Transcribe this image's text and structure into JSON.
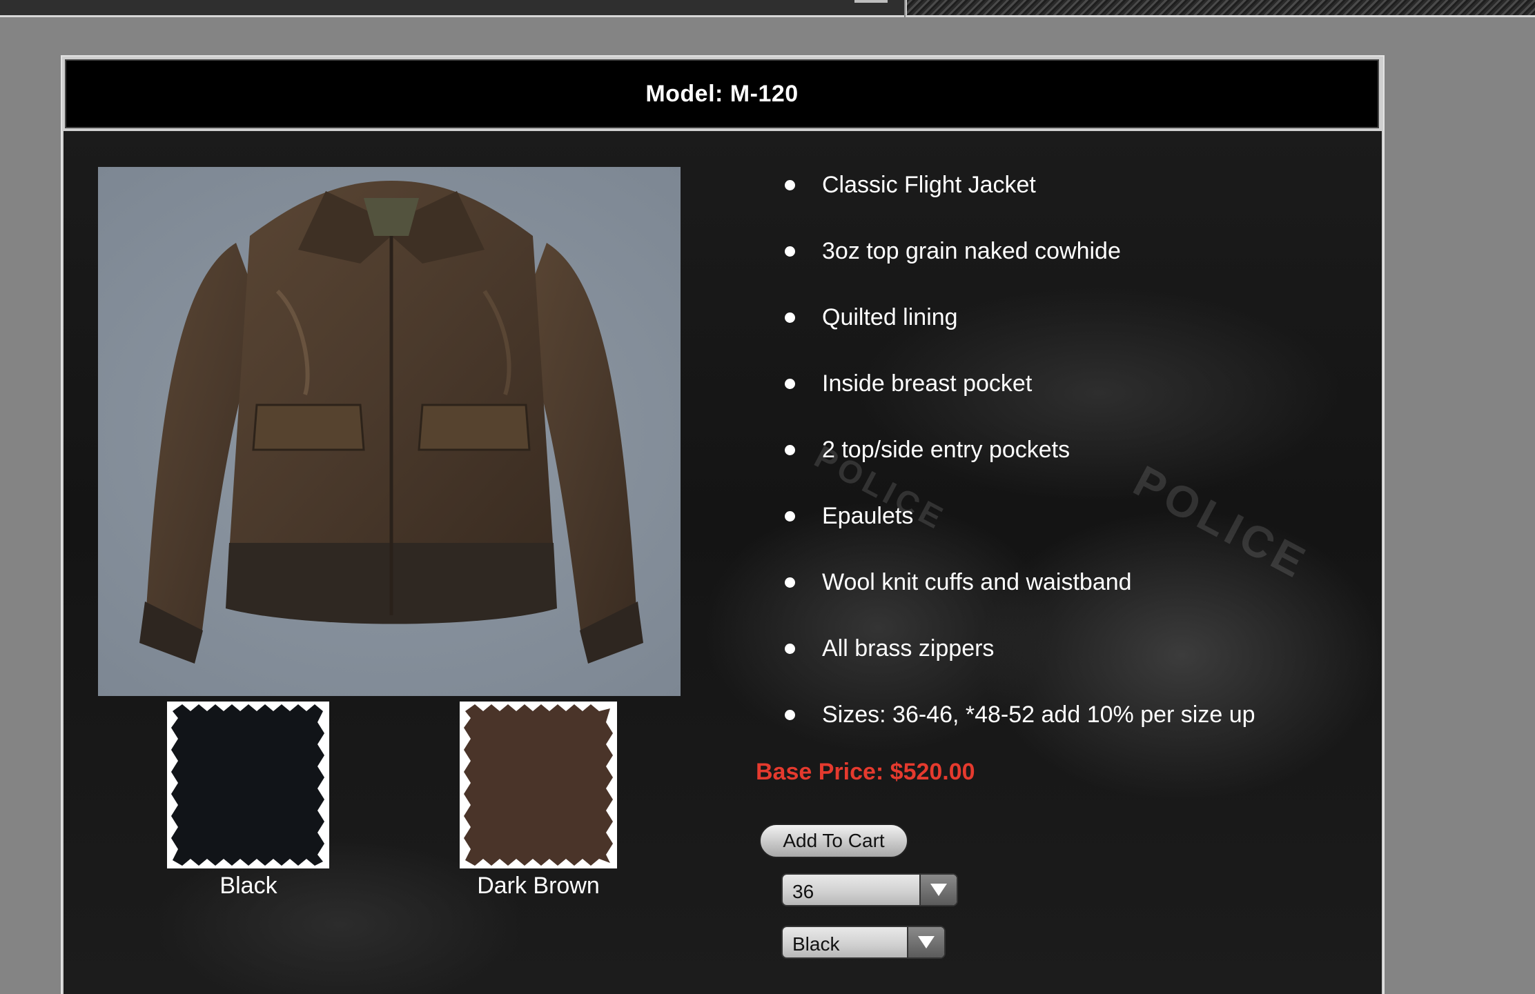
{
  "header": {
    "model_title": "Model: M-120"
  },
  "product": {
    "photo_alt": "brown leather flight jacket",
    "features": [
      "Classic Flight Jacket",
      "3oz top grain naked cowhide",
      "Quilted lining",
      "Inside breast pocket",
      "2 top/side entry pockets",
      "Epaulets",
      "Wool knit cuffs and waistband",
      "All brass zippers",
      "Sizes: 36-46, *48-52 add 10% per size up"
    ],
    "price_text": "Base Price: $520.00",
    "swatches": [
      {
        "label": "Black",
        "color": "#111418"
      },
      {
        "label": "Dark Brown",
        "color": "#4a3429"
      }
    ]
  },
  "actions": {
    "add_to_cart_label": "Add To Cart",
    "size_select_value": "36",
    "color_select_value": "Black"
  },
  "background": {
    "watermark_text": "POLICE"
  },
  "colors": {
    "price": "#e53a2e",
    "header_bg": "#000000",
    "page_bg": "#848484"
  }
}
